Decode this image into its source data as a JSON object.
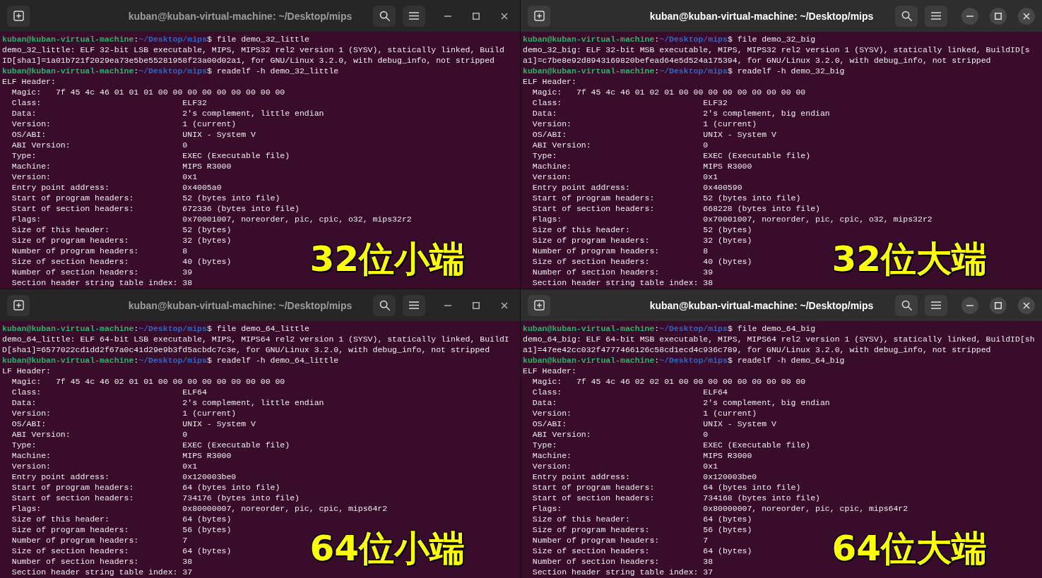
{
  "windows": [
    {
      "title": "kuban@kuban-virtual-machine: ~/Desktop/mips",
      "focused": false,
      "caption": "32位小端",
      "lines": [
        {
          "kind": "prompt",
          "user": "kuban@kuban-virtual-machine",
          "separator": ":",
          "path": "~/Desktop/mips",
          "command": "$ file demo_32_little"
        },
        {
          "kind": "output",
          "text": "demo_32_little: ELF 32-bit LSB executable, MIPS, MIPS32 rel2 version 1 (SYSV), statically linked, Build"
        },
        {
          "kind": "output",
          "text": "ID[sha1]=1a01b721f2029ea73e5be55281958f23a00d02a1, for GNU/Linux 3.2.0, with debug_info, not stripped"
        },
        {
          "kind": "prompt",
          "user": "kuban@kuban-virtual-machine",
          "separator": ":",
          "path": "~/Desktop/mips",
          "command": "$ readelf -h demo_32_little"
        },
        {
          "kind": "output",
          "text": "ELF Header:"
        },
        {
          "kind": "magic",
          "label": "Magic:",
          "value": "7f 45 4c 46 01 01 01 00 00 00 00 00 00 00 00 00"
        },
        {
          "kind": "field",
          "label": "Class:",
          "value": "ELF32"
        },
        {
          "kind": "field",
          "label": "Data:",
          "value": "2's complement, little endian"
        },
        {
          "kind": "field",
          "label": "Version:",
          "value": "1 (current)"
        },
        {
          "kind": "field",
          "label": "OS/ABI:",
          "value": "UNIX - System V"
        },
        {
          "kind": "field",
          "label": "ABI Version:",
          "value": "0"
        },
        {
          "kind": "field",
          "label": "Type:",
          "value": "EXEC (Executable file)"
        },
        {
          "kind": "field",
          "label": "Machine:",
          "value": "MIPS R3000"
        },
        {
          "kind": "field",
          "label": "Version:",
          "value": "0x1"
        },
        {
          "kind": "field",
          "label": "Entry point address:",
          "value": "0x4005a0"
        },
        {
          "kind": "field",
          "label": "Start of program headers:",
          "value": "52 (bytes into file)"
        },
        {
          "kind": "field",
          "label": "Start of section headers:",
          "value": "672336 (bytes into file)"
        },
        {
          "kind": "field",
          "label": "Flags:",
          "value": "0x70001007, noreorder, pic, cpic, o32, mips32r2"
        },
        {
          "kind": "field",
          "label": "Size of this header:",
          "value": "52 (bytes)"
        },
        {
          "kind": "field",
          "label": "Size of program headers:",
          "value": "32 (bytes)"
        },
        {
          "kind": "field",
          "label": "Number of program headers:",
          "value": "8"
        },
        {
          "kind": "field",
          "label": "Size of section headers:",
          "value": "40 (bytes)"
        },
        {
          "kind": "field",
          "label": "Number of section headers:",
          "value": "39"
        },
        {
          "kind": "field",
          "label": "Section header string table index:",
          "value": "38"
        }
      ]
    },
    {
      "title": "kuban@kuban-virtual-machine: ~/Desktop/mips",
      "focused": true,
      "caption": "32位大端",
      "lines": [
        {
          "kind": "prompt",
          "user": "kuban@kuban-virtual-machine",
          "separator": ":",
          "path": "~/Desktop/mips",
          "command": "$ file demo_32_big"
        },
        {
          "kind": "output",
          "text": "demo_32_big: ELF 32-bit MSB executable, MIPS, MIPS32 rel2 version 1 (SYSV), statically linked, BuildID[s"
        },
        {
          "kind": "output",
          "text": "a1]=c7be8e92d8943169820befead64e5d524a175394, for GNU/Linux 3.2.0, with debug_info, not stripped"
        },
        {
          "kind": "prompt",
          "user": "kuban@kuban-virtual-machine",
          "separator": ":",
          "path": "~/Desktop/mips",
          "command": "$ readelf -h demo_32_big"
        },
        {
          "kind": "output",
          "text": "ELF Header:"
        },
        {
          "kind": "magic",
          "label": "Magic:",
          "value": "7f 45 4c 46 01 02 01 00 00 00 00 00 00 00 00 00"
        },
        {
          "kind": "field",
          "label": "Class:",
          "value": "ELF32"
        },
        {
          "kind": "field",
          "label": "Data:",
          "value": "2's complement, big endian"
        },
        {
          "kind": "field",
          "label": "Version:",
          "value": "1 (current)"
        },
        {
          "kind": "field",
          "label": "OS/ABI:",
          "value": "UNIX - System V"
        },
        {
          "kind": "field",
          "label": "ABI Version:",
          "value": "0"
        },
        {
          "kind": "field",
          "label": "Type:",
          "value": "EXEC (Executable file)"
        },
        {
          "kind": "field",
          "label": "Machine:",
          "value": "MIPS R3000"
        },
        {
          "kind": "field",
          "label": "Version:",
          "value": "0x1"
        },
        {
          "kind": "field",
          "label": "Entry point address:",
          "value": "0x400590"
        },
        {
          "kind": "field",
          "label": "Start of program headers:",
          "value": "52 (bytes into file)"
        },
        {
          "kind": "field",
          "label": "Start of section headers:",
          "value": "668228 (bytes into file)"
        },
        {
          "kind": "field",
          "label": "Flags:",
          "value": "0x70001007, noreorder, pic, cpic, o32, mips32r2"
        },
        {
          "kind": "field",
          "label": "Size of this header:",
          "value": "52 (bytes)"
        },
        {
          "kind": "field",
          "label": "Size of program headers:",
          "value": "32 (bytes)"
        },
        {
          "kind": "field",
          "label": "Number of program headers:",
          "value": "8"
        },
        {
          "kind": "field",
          "label": "Size of section headers:",
          "value": "40 (bytes)"
        },
        {
          "kind": "field",
          "label": "Number of section headers:",
          "value": "39"
        },
        {
          "kind": "field",
          "label": "Section header string table index:",
          "value": "38"
        }
      ]
    },
    {
      "title": "kuban@kuban-virtual-machine: ~/Desktop/mips",
      "focused": false,
      "caption": "64位小端",
      "lines": [
        {
          "kind": "prompt",
          "user": "kuban@kuban-virtual-machine",
          "separator": ":",
          "path": "~/Desktop/mips",
          "command": "$ file demo_64_little"
        },
        {
          "kind": "output",
          "text": "demo_64_little: ELF 64-bit LSB executable, MIPS, MIPS64 rel2 version 1 (SYSV), statically linked, BuildI"
        },
        {
          "kind": "output",
          "text": "D[sha1]=6577022cd1dd2f67a0c41d29e9b3fd5acbdc7c3e, for GNU/Linux 3.2.0, with debug_info, not stripped"
        },
        {
          "kind": "prompt",
          "user": "kuban@kuban-virtual-machine",
          "separator": ":",
          "path": "~/Desktop/mips",
          "command": "$ readelf -h demo_64_little"
        },
        {
          "kind": "output",
          "text": "LF Header:"
        },
        {
          "kind": "magic",
          "label": "Magic:",
          "value": "7f 45 4c 46 02 01 01 00 00 00 00 00 00 00 00 00"
        },
        {
          "kind": "field",
          "label": "Class:",
          "value": "ELF64"
        },
        {
          "kind": "field",
          "label": "Data:",
          "value": "2's complement, little endian"
        },
        {
          "kind": "field",
          "label": "Version:",
          "value": "1 (current)"
        },
        {
          "kind": "field",
          "label": "OS/ABI:",
          "value": "UNIX - System V"
        },
        {
          "kind": "field",
          "label": "ABI Version:",
          "value": "0"
        },
        {
          "kind": "field",
          "label": "Type:",
          "value": "EXEC (Executable file)"
        },
        {
          "kind": "field",
          "label": "Machine:",
          "value": "MIPS R3000"
        },
        {
          "kind": "field",
          "label": "Version:",
          "value": "0x1"
        },
        {
          "kind": "field",
          "label": "Entry point address:",
          "value": "0x120003be0"
        },
        {
          "kind": "field",
          "label": "Start of program headers:",
          "value": "64 (bytes into file)"
        },
        {
          "kind": "field",
          "label": "Start of section headers:",
          "value": "734176 (bytes into file)"
        },
        {
          "kind": "field",
          "label": "Flags:",
          "value": "0x80000007, noreorder, pic, cpic, mips64r2"
        },
        {
          "kind": "field",
          "label": "Size of this header:",
          "value": "64 (bytes)"
        },
        {
          "kind": "field",
          "label": "Size of program headers:",
          "value": "56 (bytes)"
        },
        {
          "kind": "field",
          "label": "Number of program headers:",
          "value": "7"
        },
        {
          "kind": "field",
          "label": "Size of section headers:",
          "value": "64 (bytes)"
        },
        {
          "kind": "field",
          "label": "Number of section headers:",
          "value": "38"
        },
        {
          "kind": "field",
          "label": "Section header string table index:",
          "value": "37"
        }
      ]
    },
    {
      "title": "kuban@kuban-virtual-machine: ~/Desktop/mips",
      "focused": true,
      "caption": "64位大端",
      "lines": [
        {
          "kind": "prompt",
          "user": "kuban@kuban-virtual-machine",
          "separator": ":",
          "path": "~/Desktop/mips",
          "command": "$ file demo_64_big"
        },
        {
          "kind": "output",
          "text": "demo_64_big: ELF 64-bit MSB executable, MIPS, MIPS64 rel2 version 1 (SYSV), statically linked, BuildID[sh"
        },
        {
          "kind": "output",
          "text": "a1]=47ee42cc032f4777466126c58cd1ecd4c936c789, for GNU/Linux 3.2.0, with debug_info, not stripped"
        },
        {
          "kind": "prompt",
          "user": "kuban@kuban-virtual-machine",
          "separator": ":",
          "path": "~/Desktop/mips",
          "command": "$ readelf -h demo_64_big"
        },
        {
          "kind": "output",
          "text": "ELF Header:"
        },
        {
          "kind": "magic",
          "label": "Magic:",
          "value": "7f 45 4c 46 02 02 01 00 00 00 00 00 00 00 00 00"
        },
        {
          "kind": "field",
          "label": "Class:",
          "value": "ELF64"
        },
        {
          "kind": "field",
          "label": "Data:",
          "value": "2's complement, big endian"
        },
        {
          "kind": "field",
          "label": "Version:",
          "value": "1 (current)"
        },
        {
          "kind": "field",
          "label": "OS/ABI:",
          "value": "UNIX - System V"
        },
        {
          "kind": "field",
          "label": "ABI Version:",
          "value": "0"
        },
        {
          "kind": "field",
          "label": "Type:",
          "value": "EXEC (Executable file)"
        },
        {
          "kind": "field",
          "label": "Machine:",
          "value": "MIPS R3000"
        },
        {
          "kind": "field",
          "label": "Version:",
          "value": "0x1"
        },
        {
          "kind": "field",
          "label": "Entry point address:",
          "value": "0x120003be0"
        },
        {
          "kind": "field",
          "label": "Start of program headers:",
          "value": "64 (bytes into file)"
        },
        {
          "kind": "field",
          "label": "Start of section headers:",
          "value": "734168 (bytes into file)"
        },
        {
          "kind": "field",
          "label": "Flags:",
          "value": "0x80000007, noreorder, pic, cpic, mips64r2"
        },
        {
          "kind": "field",
          "label": "Size of this header:",
          "value": "64 (bytes)"
        },
        {
          "kind": "field",
          "label": "Size of program headers:",
          "value": "56 (bytes)"
        },
        {
          "kind": "field",
          "label": "Number of program headers:",
          "value": "7"
        },
        {
          "kind": "field",
          "label": "Size of section headers:",
          "value": "64 (bytes)"
        },
        {
          "kind": "field",
          "label": "Number of section headers:",
          "value": "38"
        },
        {
          "kind": "field",
          "label": "Section header string table index:",
          "value": "37"
        }
      ]
    }
  ]
}
